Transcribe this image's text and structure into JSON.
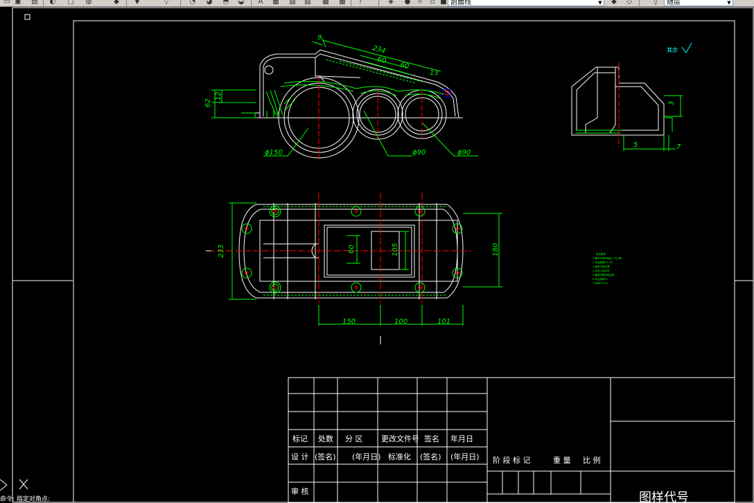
{
  "toolbar": {
    "layer_combo_value": "剖面线",
    "linetype_combo_value": "随层",
    "icons": [
      "open-icon",
      "save-icon",
      "print-icon",
      "undo-icon",
      "redo-icon",
      "zoom-realtime-icon",
      "zoom-window-icon",
      "zoom-previous-icon",
      "text-style-icon",
      "table-icon",
      "help-icon",
      "layer-manager-icon",
      "layer-state-icon",
      "color-icon"
    ]
  },
  "drawing": {
    "roughness_text": "其余",
    "front_view_dims": {
      "d1": "9",
      "d2": "234",
      "d3": "60",
      "d4": "60",
      "d5": "13",
      "d6": "62",
      "d7": "12",
      "dia1": "ϕ150",
      "dia2": "ϕ90",
      "dia3": "ϕ90"
    },
    "side_view_dims": {
      "d1": "3",
      "d2": "5",
      "d3": "7"
    },
    "top_view_dims": {
      "d1": "233",
      "d2": "180",
      "d3": "60",
      "d4": "105",
      "d5": "150",
      "d6": "100",
      "d7": "101"
    },
    "notes_title": "技术要求",
    "notes_lines": [
      "1.铸件不得有裂纹、气孔等",
      "2.未注圆角R3~R5",
      "3.铸件时效处理",
      "4.非加工面涂漆",
      "5.箱体内壁涂耐油漆",
      "6.未注倒角C1",
      "7.材料HT200"
    ]
  },
  "title_block": {
    "labels": {
      "mark": "标记",
      "count": "处数",
      "zone": "分  区",
      "change_doc": "更改文件号",
      "sign": "签名",
      "date": "年月日",
      "design": "设  计",
      "sign_paren": "(签名)",
      "date_paren": "(年月日)",
      "standardize": "标准化",
      "sign_paren2": "(签名)",
      "date_paren2": "(年月日)",
      "stage_mark": "阶 段 标 记",
      "weight": "重  量",
      "scale": "比  例",
      "review": "审  核",
      "drawing_no": "图样代号"
    }
  },
  "command_line": {
    "text": "命令: 指定对角点:"
  },
  "colors": {
    "white": "#ffffff",
    "green": "#00ff00",
    "red": "#ff0000",
    "yellow": "#ffff00",
    "cyan": "#00ffff",
    "blue": "#0000ff",
    "background": "#000000"
  }
}
